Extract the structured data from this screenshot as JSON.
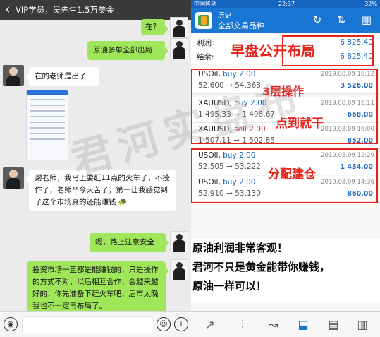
{
  "chat": {
    "back_icon": "‹",
    "title": "VIP学员，吴先生1.5万美金",
    "messages": [
      {
        "text": "在？"
      },
      {
        "text": "原油多单全部出局"
      },
      {
        "text": "在的老师是出了"
      },
      {
        "text": "谢老师，我马上要赶11点的火车了，不操作了，老师辛今天苦了，第一让我感觉到了这个市场真的还能赚钱"
      },
      {
        "text": "嗯，路上注意安全"
      },
      {
        "text": "投资市场一直都是能赚钱的，只是操作的方式不对，以后相互合作，会越来越好的，你先准备下赶火车吧，后市太晚我也不一定再布局了。"
      }
    ],
    "emoji": "🐢",
    "input_icons": {
      "voice": "◉",
      "emoji": "☺",
      "plus": "+"
    }
  },
  "app": {
    "status": {
      "carrier": "中国移动",
      "time": "22:37",
      "battery": "32%"
    },
    "header": {
      "line1": "历史",
      "line2": "全部交易品种",
      "icons": [
        "↻",
        "⇅",
        "▦"
      ]
    },
    "summary": {
      "profit_label": "利润:",
      "profit_value": "6 825.40",
      "balance_label": "结余:",
      "balance_value": "6 825.40"
    },
    "trades": [
      {
        "symbol": "USOil,",
        "side": "buy 2.00",
        "prices": "52.600 → 54.363",
        "time": "2019.08.09 16:12",
        "profit": "3 526.00"
      },
      {
        "symbol": "XAUUSD,",
        "side": "buy 2.00",
        "prices": "1 495.33 → 1 498.67",
        "time": "2019.08.09 16:11",
        "profit": "668.00"
      },
      {
        "symbol": "XAUUSD,",
        "side": "sell 2.00",
        "prices": "1 507.11 → 1 502.85",
        "time": "2019.08.09 16:00",
        "profit": "852.00"
      },
      {
        "symbol": "USOil,",
        "side": "buy 2.00",
        "prices": "52.505 → 53.222",
        "time": "2019.08.09 12:29",
        "profit": "1 434.00"
      },
      {
        "symbol": "USOil,",
        "side": "buy 2.00",
        "prices": "52.910 → 53.130",
        "time": "2019.08.09 14:36",
        "profit": "860.00"
      }
    ],
    "nav_icons": [
      "↗",
      "⫶",
      "↝",
      "⬓",
      "▤",
      "▥"
    ]
  },
  "overlay": {
    "title": "早盘公开布局",
    "label1": "3层操作",
    "label2": "点到就干",
    "label3": "分配建仓",
    "watermark": "君河实盘布"
  },
  "annotation": {
    "line1": "原油利润非常客观！",
    "line2": "君河不只是黄金能带你赚钱，",
    "line3": "原油一样可以！"
  },
  "colors": {
    "chat_bg": "#ebebeb",
    "bubble_out": "#9fe65b",
    "app_blue": "#1976d2",
    "annotation_red": "#e8231b"
  }
}
